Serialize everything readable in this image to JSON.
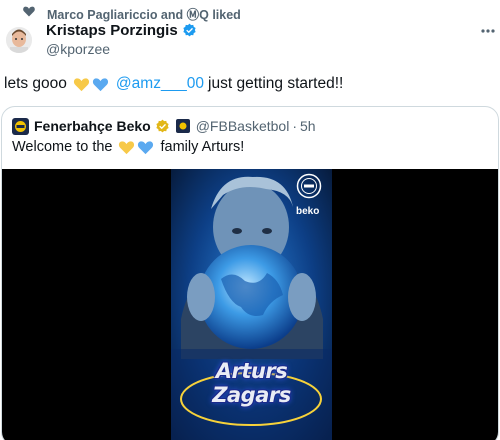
{
  "social_context": {
    "text": "Marco Pagliariccio and ⓂQ liked"
  },
  "tweet": {
    "author_name": "Kristaps Porzingis",
    "author_handle": "@kporzee",
    "text_before": "lets gooo",
    "mention": "@amz___00",
    "text_after": "just getting started!!"
  },
  "quoted": {
    "name": "Fenerbahçe Beko",
    "handle": "@FBBasketbol",
    "separator": "·",
    "time": "5h",
    "text_before": "Welcome to the",
    "text_after": "family Arturs!"
  },
  "media": {
    "poster_first_name": "Arturs",
    "poster_last_name": "Zagars",
    "sponsor": "beko"
  },
  "colors": {
    "accent_blue": "#1d9bf0",
    "yellow_heart": "#f7c948",
    "blue_heart": "#5aa9f0",
    "muted": "#536471"
  },
  "icons": [
    "heart-icon",
    "verified-icon",
    "more-icon",
    "gold-badge-icon",
    "flag-badge-icon"
  ]
}
